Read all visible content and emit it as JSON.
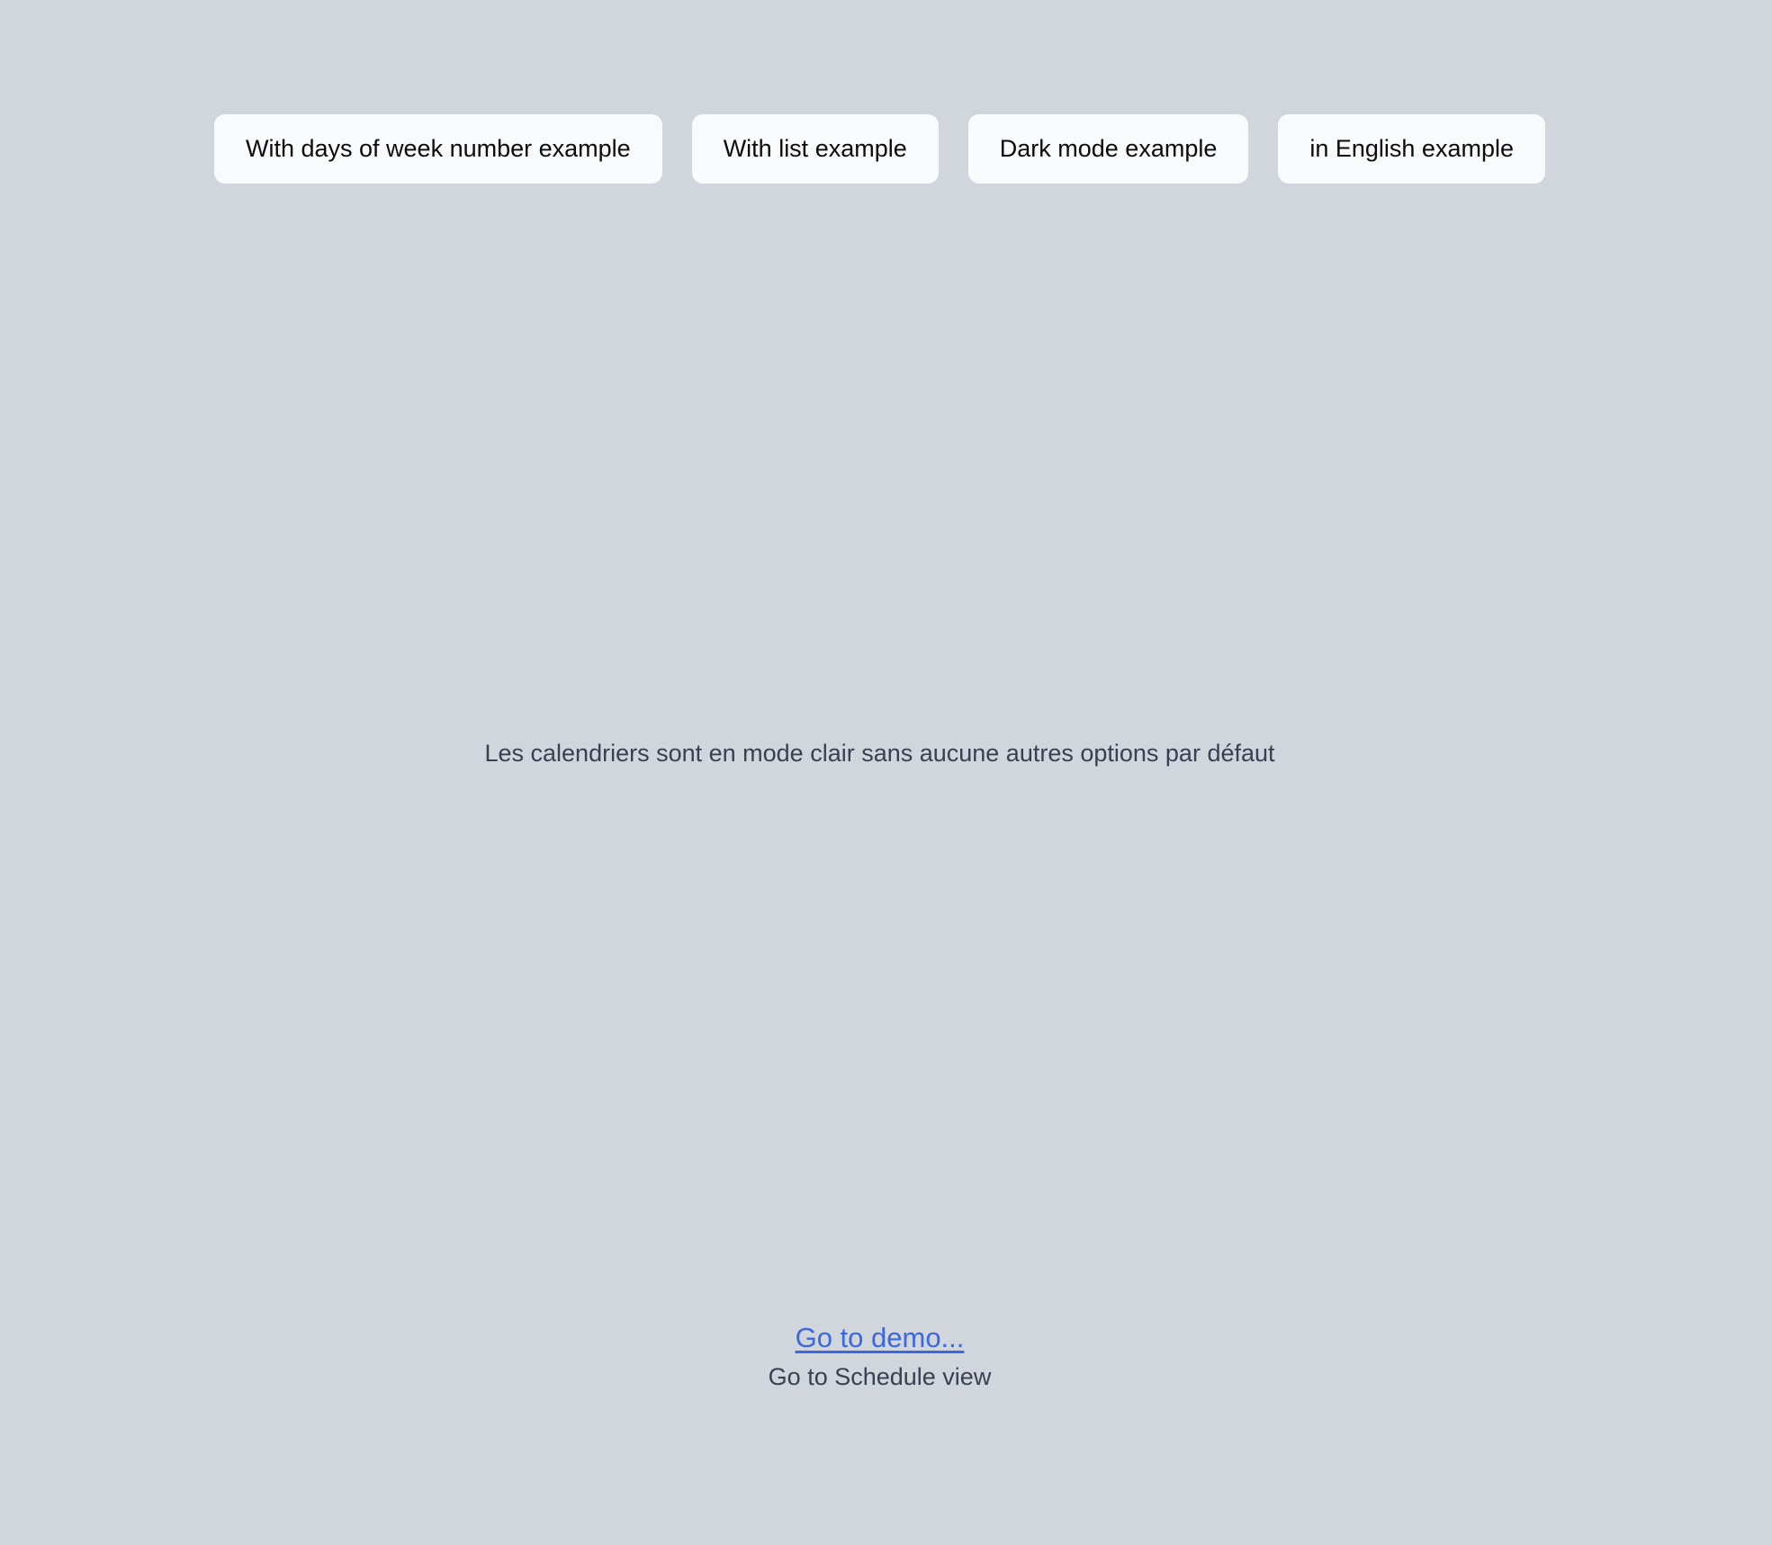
{
  "example_buttons": [
    {
      "label": "With days of week number example"
    },
    {
      "label": "With list example"
    },
    {
      "label": "Dark mode example"
    },
    {
      "label": "in English example"
    }
  ],
  "main": {
    "info_text": "Les calendriers sont en mode clair sans aucune autres options par défaut"
  },
  "footer": {
    "demo_link_label": "Go to demo...",
    "schedule_view_label": "Go to Schedule view"
  },
  "colors": {
    "background": "#d1d5dc",
    "button_background": "#f9fafb",
    "link": "#3b67e0",
    "text": "#374151"
  }
}
